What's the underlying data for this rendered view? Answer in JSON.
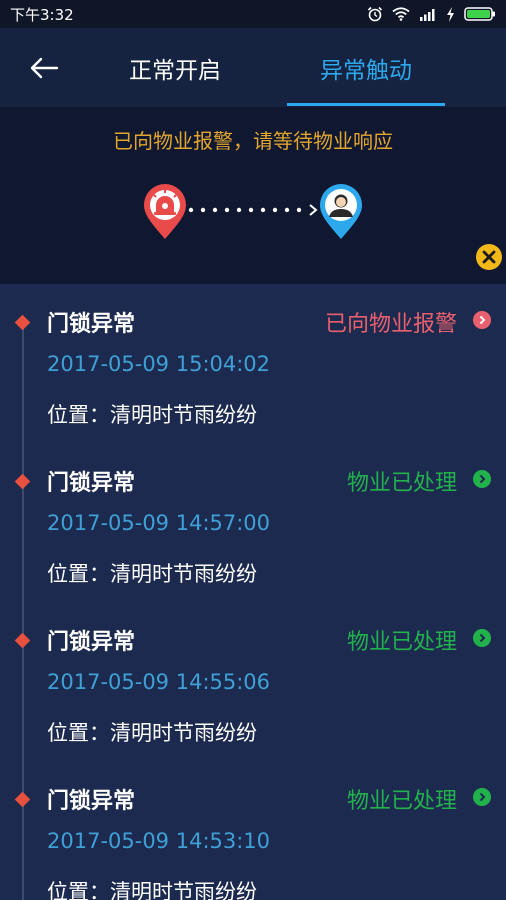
{
  "status_bar": {
    "time": "下午3:32"
  },
  "header": {
    "tabs": [
      {
        "label": "正常开启",
        "active": false
      },
      {
        "label": "异常触动",
        "active": true
      }
    ]
  },
  "alert": {
    "message": "已向物业报警，请等待物业响应"
  },
  "colors": {
    "accent_blue": "#2ea8ec",
    "alert_yellow": "#e2a52e",
    "status_red": "#e8606e",
    "status_green": "#22b24c",
    "time_blue": "#3fa0d6"
  },
  "events": [
    {
      "title": "门锁异常",
      "status": "已向物业报警",
      "status_type": "red",
      "time": "2017-05-09 15:04:02",
      "location": "位置：清明时节雨纷纷"
    },
    {
      "title": "门锁异常",
      "status": "物业已处理",
      "status_type": "green",
      "time": "2017-05-09 14:57:00",
      "location": "位置：清明时节雨纷纷"
    },
    {
      "title": "门锁异常",
      "status": "物业已处理",
      "status_type": "green",
      "time": "2017-05-09 14:55:06",
      "location": "位置：清明时节雨纷纷"
    },
    {
      "title": "门锁异常",
      "status": "物业已处理",
      "status_type": "green",
      "time": "2017-05-09 14:53:10",
      "location": "位置：清明时节雨纷纷"
    }
  ]
}
